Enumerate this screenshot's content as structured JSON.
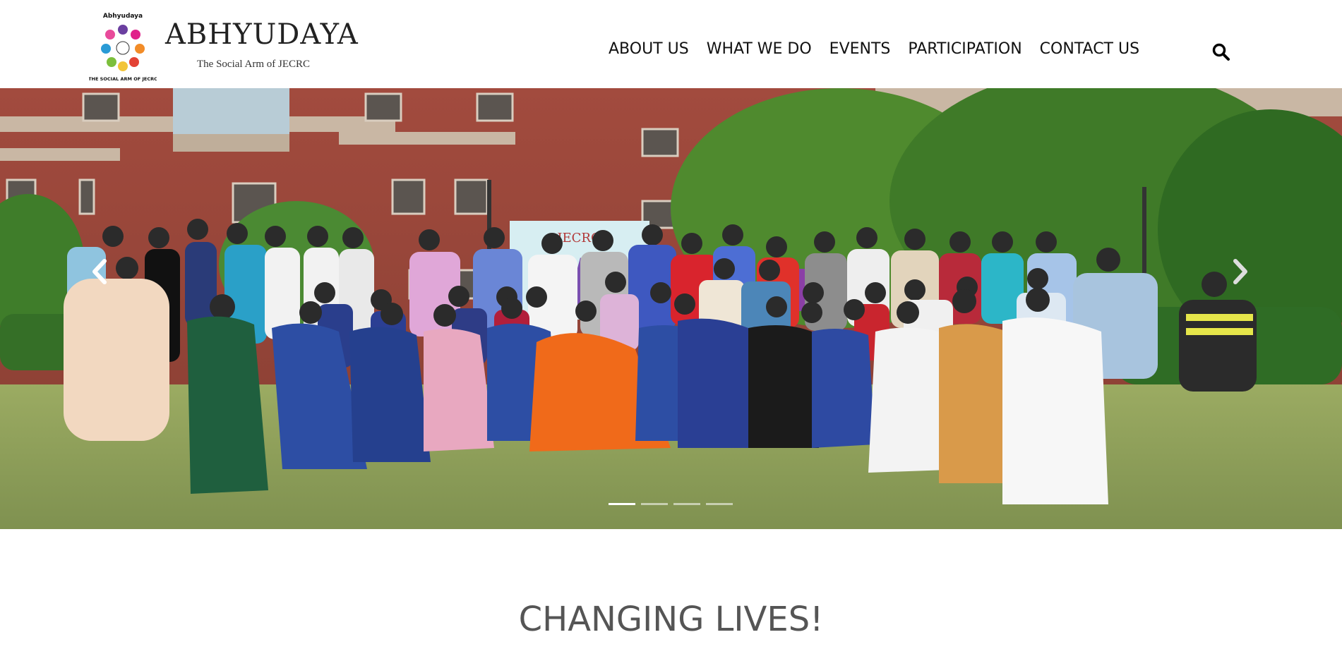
{
  "brand": {
    "title": "ABHYUDAYA",
    "tagline": "The Social Arm of JECRC",
    "logo_top_text": "Abhyudaya",
    "logo_ring_text": "THE SOCIAL ARM OF JECRC"
  },
  "nav": {
    "items": [
      {
        "label": "ABOUT US"
      },
      {
        "label": "WHAT WE DO"
      },
      {
        "label": "EVENTS"
      },
      {
        "label": "PARTICIPATION"
      },
      {
        "label": "CONTACT US"
      }
    ],
    "search_icon": "search-icon"
  },
  "hero": {
    "image_alt": "Group photo of Abhyudaya members on a campus lawn",
    "banner_text": "JECRC",
    "slide_count": 4,
    "active_slide": 1,
    "prev_icon": "chevron-left-icon",
    "next_icon": "chevron-right-icon"
  },
  "main": {
    "heading": "CHANGING LIVES!"
  },
  "colors": {
    "brick": "#a0493c",
    "grass": "#8ea35a",
    "foliage": "#3f7d2a",
    "text": "#111111",
    "heading": "#555555"
  }
}
